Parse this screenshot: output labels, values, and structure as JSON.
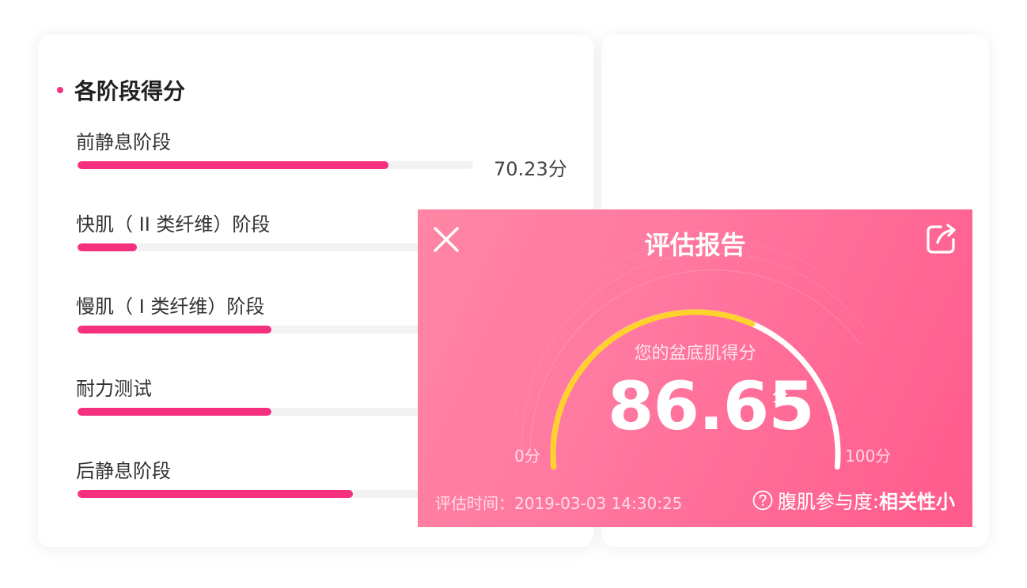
{
  "section": {
    "title": "各阶段得分"
  },
  "stages": [
    {
      "label": "前静息阶段",
      "score": "70.23分",
      "fill": 0.785
    },
    {
      "label": "快肌（ II 类纤维）阶段",
      "score": "",
      "fill": 0.15
    },
    {
      "label": "慢肌（ I 类纤维）阶段",
      "score": "",
      "fill": 0.49
    },
    {
      "label": "耐力测试",
      "score": "",
      "fill": 0.49
    },
    {
      "label": "后静息阶段",
      "score": "",
      "fill": 0.695
    }
  ],
  "report": {
    "title": "评估报告",
    "caption": "您的盆底肌得分",
    "score": "86.65",
    "score_unit": "分",
    "score_fraction": 0.8665,
    "min_label": "0分",
    "max_label": "100分",
    "eval_time": "评估时间：2019-03-03 14:30:25",
    "muscle_label": "腹肌参与度:",
    "muscle_value": "相关性小",
    "colors": {
      "accent": "#f5317f",
      "gauge_progress": "#ffd12b",
      "gauge_track": "#ffffff"
    },
    "icons": {
      "close": "close-icon",
      "share": "share-icon",
      "help": "help-icon"
    }
  }
}
